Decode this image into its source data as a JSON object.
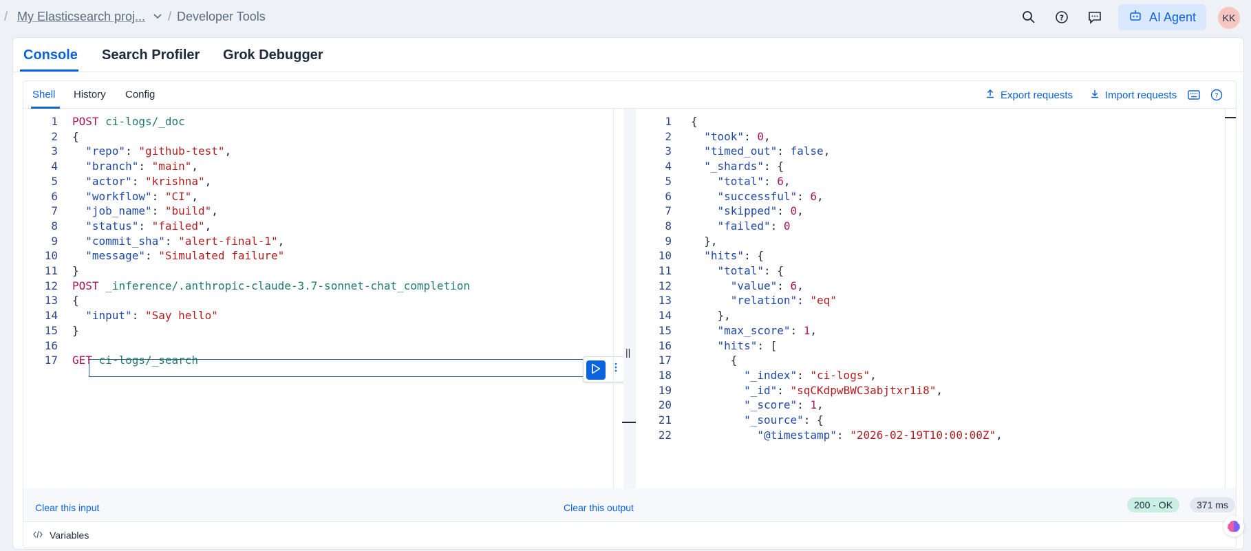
{
  "breadcrumb": {
    "project": "My Elasticsearch proj...",
    "current": "Developer Tools"
  },
  "header": {
    "ai_agent_label": "AI Agent",
    "avatar_initials": "KK"
  },
  "main_tabs": [
    "Console",
    "Search Profiler",
    "Grok Debugger"
  ],
  "sub_tabs": [
    "Shell",
    "History",
    "Config"
  ],
  "toolbar": {
    "export_label": "Export requests",
    "import_label": "Import requests"
  },
  "request_editor": {
    "lines": [
      [
        [
          "k",
          "POST"
        ],
        [
          "p",
          " "
        ],
        [
          "u",
          "ci-logs/_doc"
        ]
      ],
      [
        [
          "p",
          "{"
        ]
      ],
      [
        [
          "p",
          "  "
        ],
        [
          "s",
          "\"repo\""
        ],
        [
          "p",
          ": "
        ],
        [
          "v",
          "\"github-test\""
        ],
        [
          "p",
          ","
        ]
      ],
      [
        [
          "p",
          "  "
        ],
        [
          "s",
          "\"branch\""
        ],
        [
          "p",
          ": "
        ],
        [
          "v",
          "\"main\""
        ],
        [
          "p",
          ","
        ]
      ],
      [
        [
          "p",
          "  "
        ],
        [
          "s",
          "\"actor\""
        ],
        [
          "p",
          ": "
        ],
        [
          "v",
          "\"krishna\""
        ],
        [
          "p",
          ","
        ]
      ],
      [
        [
          "p",
          "  "
        ],
        [
          "s",
          "\"workflow\""
        ],
        [
          "p",
          ": "
        ],
        [
          "v",
          "\"CI\""
        ],
        [
          "p",
          ","
        ]
      ],
      [
        [
          "p",
          "  "
        ],
        [
          "s",
          "\"job_name\""
        ],
        [
          "p",
          ": "
        ],
        [
          "v",
          "\"build\""
        ],
        [
          "p",
          ","
        ]
      ],
      [
        [
          "p",
          "  "
        ],
        [
          "s",
          "\"status\""
        ],
        [
          "p",
          ": "
        ],
        [
          "v",
          "\"failed\""
        ],
        [
          "p",
          ","
        ]
      ],
      [
        [
          "p",
          "  "
        ],
        [
          "s",
          "\"commit_sha\""
        ],
        [
          "p",
          ": "
        ],
        [
          "v",
          "\"alert-final-1\""
        ],
        [
          "p",
          ","
        ]
      ],
      [
        [
          "p",
          "  "
        ],
        [
          "s",
          "\"message\""
        ],
        [
          "p",
          ": "
        ],
        [
          "v",
          "\"Simulated failure\""
        ]
      ],
      [
        [
          "p",
          "}"
        ]
      ],
      [
        [
          "k",
          "POST"
        ],
        [
          "p",
          " "
        ],
        [
          "u",
          "_inference/.anthropic-claude-3.7-sonnet-chat_completion"
        ]
      ],
      [
        [
          "p",
          "{"
        ]
      ],
      [
        [
          "p",
          "  "
        ],
        [
          "s",
          "\"input\""
        ],
        [
          "p",
          ": "
        ],
        [
          "v",
          "\"Say hello\""
        ]
      ],
      [
        [
          "p",
          "}"
        ]
      ],
      [],
      [
        [
          "k",
          "GET"
        ],
        [
          "p",
          " "
        ],
        [
          "u",
          "ci-logs/_search"
        ]
      ]
    ]
  },
  "response_editor": {
    "lines": [
      [
        [
          "p",
          "{"
        ]
      ],
      [
        [
          "p",
          "  "
        ],
        [
          "s",
          "\"took\""
        ],
        [
          "p",
          ": "
        ],
        [
          "n",
          "0"
        ],
        [
          "p",
          ","
        ]
      ],
      [
        [
          "p",
          "  "
        ],
        [
          "s",
          "\"timed_out\""
        ],
        [
          "p",
          ": "
        ],
        [
          "b",
          "false"
        ],
        [
          "p",
          ","
        ]
      ],
      [
        [
          "p",
          "  "
        ],
        [
          "s",
          "\"_shards\""
        ],
        [
          "p",
          ": {"
        ]
      ],
      [
        [
          "p",
          "    "
        ],
        [
          "s",
          "\"total\""
        ],
        [
          "p",
          ": "
        ],
        [
          "n",
          "6"
        ],
        [
          "p",
          ","
        ]
      ],
      [
        [
          "p",
          "    "
        ],
        [
          "s",
          "\"successful\""
        ],
        [
          "p",
          ": "
        ],
        [
          "n",
          "6"
        ],
        [
          "p",
          ","
        ]
      ],
      [
        [
          "p",
          "    "
        ],
        [
          "s",
          "\"skipped\""
        ],
        [
          "p",
          ": "
        ],
        [
          "n",
          "0"
        ],
        [
          "p",
          ","
        ]
      ],
      [
        [
          "p",
          "    "
        ],
        [
          "s",
          "\"failed\""
        ],
        [
          "p",
          ": "
        ],
        [
          "n",
          "0"
        ]
      ],
      [
        [
          "p",
          "  },"
        ]
      ],
      [
        [
          "p",
          "  "
        ],
        [
          "s",
          "\"hits\""
        ],
        [
          "p",
          ": {"
        ]
      ],
      [
        [
          "p",
          "    "
        ],
        [
          "s",
          "\"total\""
        ],
        [
          "p",
          ": {"
        ]
      ],
      [
        [
          "p",
          "      "
        ],
        [
          "s",
          "\"value\""
        ],
        [
          "p",
          ": "
        ],
        [
          "n",
          "6"
        ],
        [
          "p",
          ","
        ]
      ],
      [
        [
          "p",
          "      "
        ],
        [
          "s",
          "\"relation\""
        ],
        [
          "p",
          ": "
        ],
        [
          "v",
          "\"eq\""
        ]
      ],
      [
        [
          "p",
          "    },"
        ]
      ],
      [
        [
          "p",
          "    "
        ],
        [
          "s",
          "\"max_score\""
        ],
        [
          "p",
          ": "
        ],
        [
          "n",
          "1"
        ],
        [
          "p",
          ","
        ]
      ],
      [
        [
          "p",
          "    "
        ],
        [
          "s",
          "\"hits\""
        ],
        [
          "p",
          ": ["
        ]
      ],
      [
        [
          "p",
          "      {"
        ]
      ],
      [
        [
          "p",
          "        "
        ],
        [
          "s",
          "\"_index\""
        ],
        [
          "p",
          ": "
        ],
        [
          "v",
          "\"ci-logs\""
        ],
        [
          "p",
          ","
        ]
      ],
      [
        [
          "p",
          "        "
        ],
        [
          "s",
          "\"_id\""
        ],
        [
          "p",
          ": "
        ],
        [
          "v",
          "\"sqCKdpwBWC3abjtxr1i8\""
        ],
        [
          "p",
          ","
        ]
      ],
      [
        [
          "p",
          "        "
        ],
        [
          "s",
          "\"_score\""
        ],
        [
          "p",
          ": "
        ],
        [
          "n",
          "1"
        ],
        [
          "p",
          ","
        ]
      ],
      [
        [
          "p",
          "        "
        ],
        [
          "s",
          "\"_source\""
        ],
        [
          "p",
          ": {"
        ]
      ],
      [
        [
          "p",
          "          "
        ],
        [
          "s",
          "\"@timestamp\""
        ],
        [
          "p",
          ": "
        ],
        [
          "v",
          "\"2026-02-19T10:00:00Z\""
        ],
        [
          "p",
          ","
        ]
      ]
    ]
  },
  "footer": {
    "clear_input": "Clear this input",
    "clear_output": "Clear this output",
    "status_badge": "200 - OK",
    "time_badge": "371 ms",
    "variables_label": "Variables"
  },
  "colors": {
    "accent": "#0b64dd",
    "status_ok_bg": "#c9efe0"
  },
  "icons": {
    "search": "search-icon",
    "help": "help-icon",
    "feedback": "chat-icon",
    "robot": "robot-icon",
    "export": "upload-icon",
    "import": "download-icon",
    "keyboard": "keyboard-icon",
    "play": "play-icon",
    "menu": "kebab-icon",
    "variables": "code-icon"
  }
}
